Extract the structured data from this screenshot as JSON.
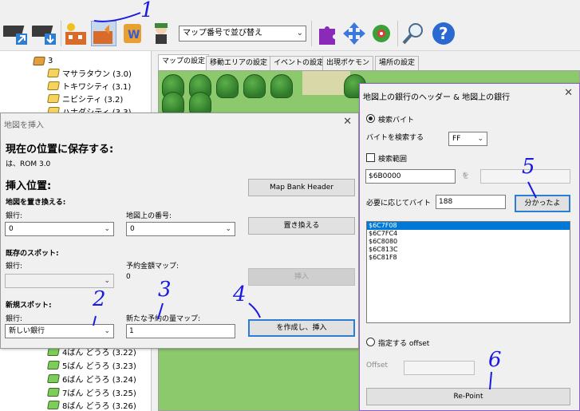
{
  "toolbar": {
    "sort_value": "マップ番号で並び替え",
    "icons": [
      "save-as-icon",
      "open-import-icon",
      "map-insert-icon",
      "map-insert-alt-icon",
      "script-editor-icon",
      "trainer-icon",
      "puzzle-icon",
      "move-arrows-icon",
      "gear-icon",
      "search-icon",
      "help-icon"
    ]
  },
  "tree": {
    "items": [
      {
        "label": "3",
        "icon": "folder"
      },
      {
        "label": "マサラタウン (3.0)",
        "icon": "yellow"
      },
      {
        "label": "トキワシティ (3.1)",
        "icon": "yellow"
      },
      {
        "label": "ニビシティ (3.2)",
        "icon": "yellow"
      },
      {
        "label": "ハナダシティ (3.3)",
        "icon": "yellow"
      },
      {
        "label": "4ばん どうろ (3.22)",
        "icon": "green"
      },
      {
        "label": "5ばん どうろ (3.23)",
        "icon": "green"
      },
      {
        "label": "6ばん どうろ (3.24)",
        "icon": "green"
      },
      {
        "label": "7ばん どうろ (3.25)",
        "icon": "green"
      },
      {
        "label": "8ばん どうろ (3.26)",
        "icon": "green"
      }
    ]
  },
  "tabs": [
    "マップの設定",
    "移動エリアの設定",
    "イベントの設定",
    "出現ポケモン",
    "場所の設定"
  ],
  "insert_dialog": {
    "title": "地図を挿入",
    "save_heading": "現在の位置に保存する:",
    "rom_line": "は、ROM 3.0",
    "insert_heading": "挿入位置:",
    "replace_heading": "地図を置き換える:",
    "bank_label": "銀行:",
    "map_number_label": "地図上の番号:",
    "replace_bank_value": "0",
    "replace_map_value": "0",
    "existing_heading": "既存のスポット:",
    "existing_bank_label": "銀行:",
    "reserved_label": "予約金額マップ:",
    "reserved_value": "0",
    "new_heading": "新規スポット:",
    "new_bank_label": "銀行:",
    "new_bank_value": "新しい銀行",
    "new_reserved_label": "新たな予約の量マップ:",
    "new_reserved_value": "1",
    "btn_map_bank_header": "Map Bank Header",
    "btn_replace": "置き換える",
    "btn_insert": "挿入",
    "btn_create_insert": "を作成し、挿入"
  },
  "bank_dialog": {
    "title": "地図上の銀行のヘッダー & 地図上の銀行",
    "search_byte_label": "検索バイト",
    "byte_to_search_label": "バイトを検索する",
    "byte_value": "FF",
    "search_range_label": "検索範囲",
    "range_start": "$6B0000",
    "range_to": "を",
    "needed_bytes_label": "必要に応じてバイト",
    "needed_bytes_value": "188",
    "btn_found": "分かったよ",
    "results": [
      "$6C7F08",
      "$6C7FC4",
      "$6C8080",
      "$6C813C",
      "$6C81F8"
    ],
    "offset_radio_label": "指定する offset",
    "offset_label": "Offset",
    "btn_repoint": "Re-Point"
  },
  "annotations": [
    "1",
    "2",
    "3",
    "4",
    "5",
    "6"
  ],
  "colors": {
    "annotation": "#1a1ae0",
    "selection": "#0078d7",
    "default_button_border": "#2d7dd2",
    "bank_dialog_border": "#8a60c8"
  }
}
